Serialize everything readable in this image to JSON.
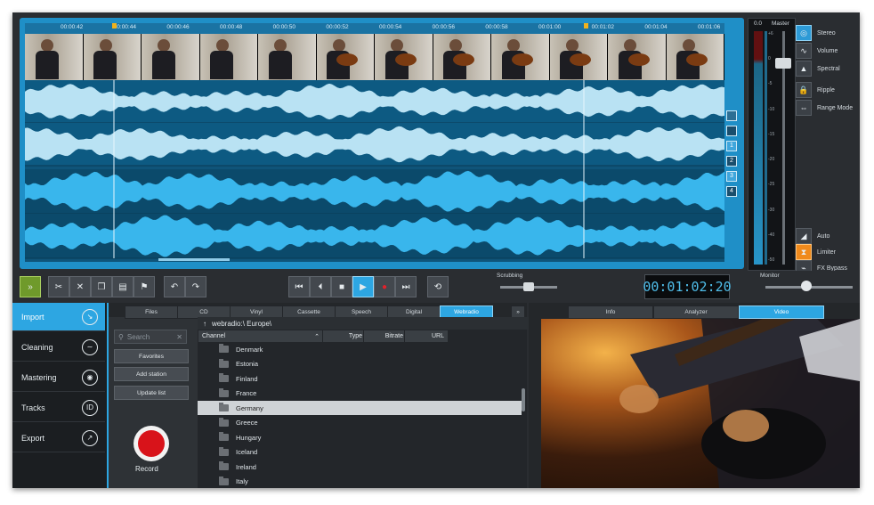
{
  "timeline": {
    "ruler_ticks": [
      "00:00:42",
      "00:00:44",
      "00:00:46",
      "00:00:48",
      "00:00:50",
      "00:00:52",
      "00:00:54",
      "00:00:56",
      "00:00:58",
      "00:01:00",
      "00:01:02",
      "00:01:04",
      "00:01:06"
    ],
    "track_numbers": [
      "1",
      "2",
      "3",
      "4"
    ]
  },
  "master": {
    "top_left": "0.0",
    "top_right": "Master",
    "scale": [
      "+6",
      "0",
      "-5",
      "-10",
      "-15",
      "-20",
      "-25",
      "-30",
      "-40",
      "-50"
    ]
  },
  "controls": {
    "stereo": "Stereo",
    "volume": "Volume",
    "spectral": "Spectral",
    "ripple": "Ripple",
    "range_mode": "Range Mode",
    "auto": "Auto",
    "limiter": "Limiter",
    "fx_bypass": "FX Bypass"
  },
  "transport": {
    "scrubbing": "Scrubbing",
    "timecode": "00:01:02:20",
    "monitor": "Monitor"
  },
  "sidebar": {
    "items": [
      {
        "label": "Import"
      },
      {
        "label": "Cleaning"
      },
      {
        "label": "Mastering"
      },
      {
        "label": "Tracks"
      },
      {
        "label": "Export"
      }
    ]
  },
  "browser": {
    "tabs": [
      "Files",
      "CD",
      "Vinyl",
      "Cassette",
      "Speech",
      "Digital",
      "Webradio"
    ],
    "more": "»",
    "search_placeholder": "Search",
    "favorites": "Favorites",
    "add_station": "Add station",
    "update_list": "Update list",
    "record": "Record",
    "path": "webradio:\\ Europe\\",
    "columns": {
      "channel": "Channel",
      "type": "Type",
      "bitrate": "Bitrate",
      "url": "URL"
    },
    "rows": [
      "Denmark",
      "Estonia",
      "Finland",
      "France",
      "Germany",
      "Greece",
      "Hungary",
      "Iceland",
      "Ireland",
      "Italy"
    ],
    "selected_row": "Germany"
  },
  "right_panel": {
    "tabs": [
      "Info",
      "Analyzer",
      "Video"
    ],
    "active_tab": "Video"
  }
}
